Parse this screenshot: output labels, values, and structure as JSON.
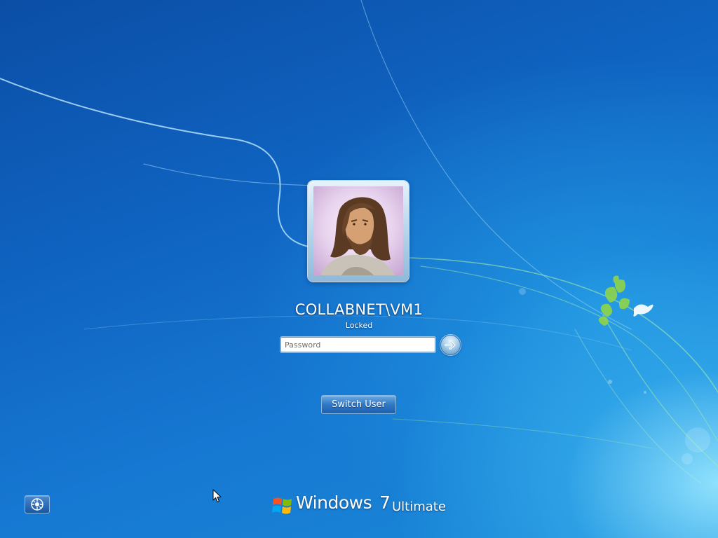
{
  "user": {
    "name": "COLLABNET\\VM1",
    "status": "Locked"
  },
  "password": {
    "placeholder": "Password",
    "value": ""
  },
  "submit": {
    "icon": "arrow-right-icon"
  },
  "switch_user": {
    "label": "Switch User"
  },
  "ease_of_access": {
    "icon": "ease-of-access-icon"
  },
  "branding": {
    "name": "Windows",
    "version": "7",
    "edition": "Ultimate"
  },
  "colors": {
    "background_dark": "#0b4ea6",
    "background_light": "#96e6ff",
    "text": "#ffffff",
    "leaf_green": "#8fd54a"
  }
}
